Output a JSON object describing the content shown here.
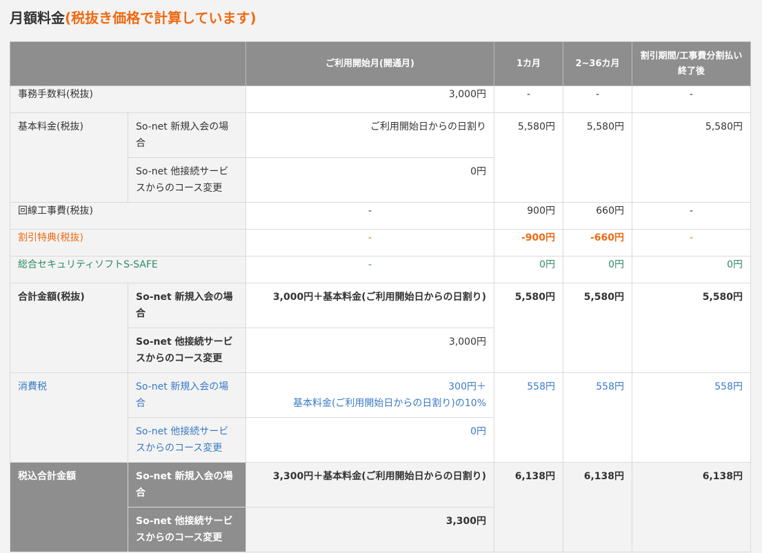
{
  "title": {
    "main": "月額料金",
    "note": "(税抜き価格で計算しています)"
  },
  "headers": {
    "blank": "",
    "start_month": "ご利用開始月(開通月)",
    "m1": "1カ月",
    "m2_36": "2~36カ月",
    "after": "割引期間/工事費分割払い終了後"
  },
  "rows": {
    "jimu": {
      "label": "事務手数料(税抜)",
      "start": "3,000円",
      "m1": "-",
      "m2": "-",
      "after": "-"
    },
    "kihon": {
      "label": "基本料金(税抜)",
      "sub_new": "So-net 新規入会の場合",
      "sub_change": "So-net 他接続サービスからのコース変更",
      "start_new": "ご利用開始日からの日割り",
      "start_change": "0円",
      "m1": "5,580円",
      "m2": "5,580円",
      "after": "5,580円"
    },
    "kaisen": {
      "label": "回線工事費(税抜)",
      "start": "-",
      "m1": "900円",
      "m2": "660円",
      "after": "-"
    },
    "waribiki": {
      "label": "割引特典(税抜)",
      "start": "-",
      "m1": "-900円",
      "m2": "-660円",
      "after": "-"
    },
    "safe": {
      "label": "総合セキュリティソフトS-SAFE",
      "start": "-",
      "m1": "0円",
      "m2": "0円",
      "after": "0円"
    },
    "goukei": {
      "label": "合計金額(税抜)",
      "sub_new": "So-net 新規入会の場合",
      "sub_change": "So-net 他接続サービスからのコース変更",
      "start_new": "3,000円＋基本料金(ご利用開始日からの日割り)",
      "start_change": "3,000円",
      "m1": "5,580円",
      "m2": "5,580円",
      "after": "5,580円"
    },
    "tax": {
      "label": "消費税",
      "sub_new": "So-net 新規入会の場合",
      "sub_change": "So-net 他接続サービスからのコース変更",
      "start_new_1": "300円＋",
      "start_new_2": "基本料金(ご利用開始日からの日割り)の10%",
      "start_change": "0円",
      "m1": "558円",
      "m2": "558円",
      "after": "558円"
    },
    "total": {
      "label": "税込合計金額",
      "sub_new": "So-net 新規入会の場合",
      "sub_change": "So-net 他接続サービスからのコース変更",
      "start_new": "3,300円＋基本料金(ご利用開始日からの日割り)",
      "start_change": "3,300円",
      "m1": "6,138円",
      "m2": "6,138円",
      "after": "6,138円"
    }
  }
}
